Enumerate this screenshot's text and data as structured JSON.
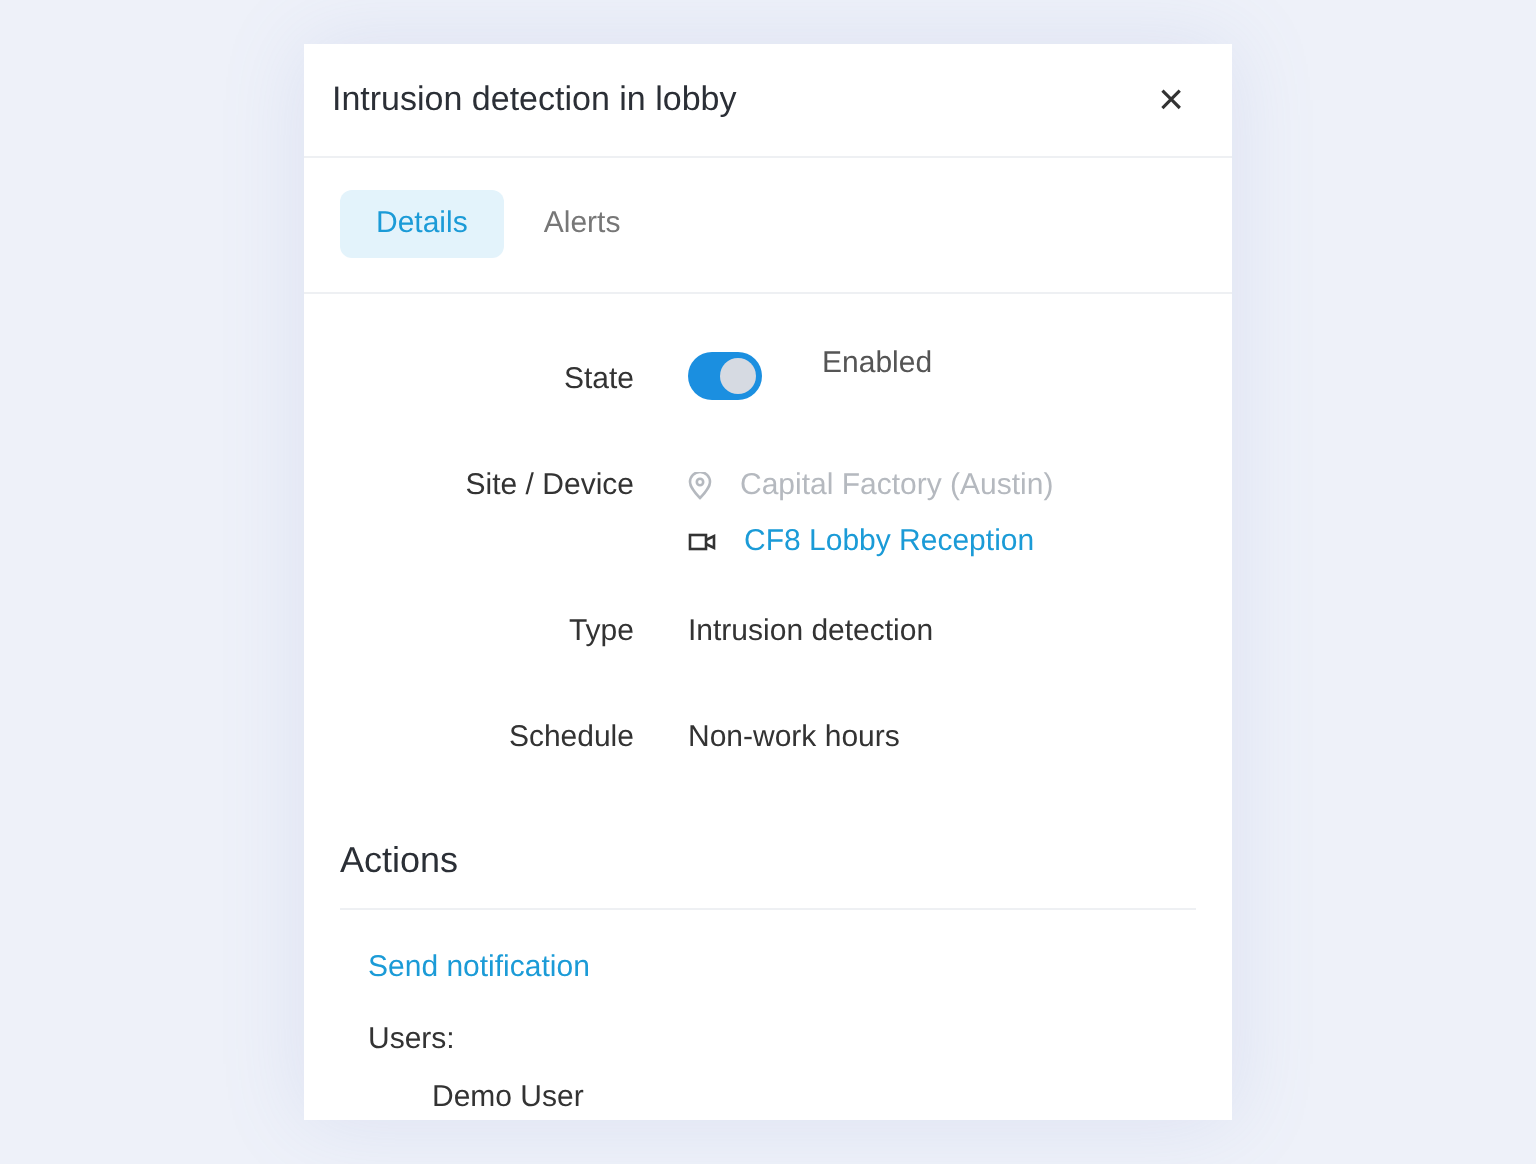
{
  "dialog": {
    "title": "Intrusion detection in lobby",
    "close": "×"
  },
  "tabs": [
    {
      "label": "Details",
      "selected": true
    },
    {
      "label": "Alerts",
      "selected": false
    }
  ],
  "details": {
    "state": {
      "label": "State",
      "on": true,
      "text": "Enabled"
    },
    "site_device": {
      "label": "Site / Device",
      "site": "Capital Factory (Austin)",
      "device": "CF8 Lobby Reception"
    },
    "type": {
      "label": "Type",
      "value": "Intrusion detection"
    },
    "schedule": {
      "label": "Schedule",
      "value": "Non-work hours"
    }
  },
  "actions": {
    "title": "Actions",
    "action": "Send notification",
    "users_label": "Users:",
    "users": [
      "Demo User"
    ]
  }
}
